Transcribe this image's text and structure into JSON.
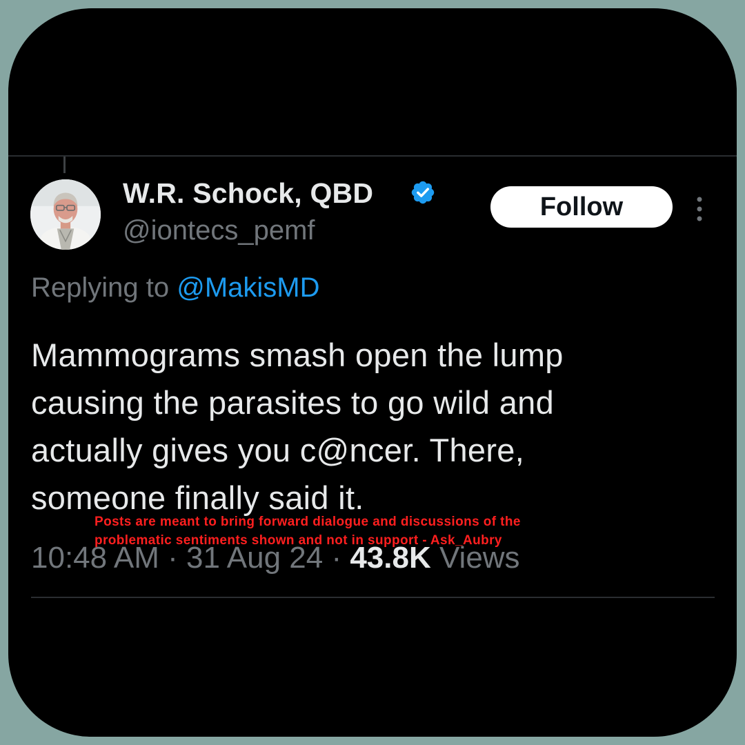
{
  "tweet": {
    "display_name": "W.R. Schock, QBD",
    "handle": "@iontecs_pemf",
    "verified": true,
    "follow_label": "Follow",
    "replying_prefix": "Replying to",
    "replying_handle": "@MakisMD",
    "text_lines": [
      "Mammograms smash open the lump",
      "causing the parasites to go wild and",
      "actually gives you c@ncer. There,",
      "someone finally said it."
    ],
    "time": "10:48 AM",
    "date": "31 Aug 24",
    "views_count": "43.8K",
    "views_label": "Views",
    "separator": " · "
  },
  "overlay": {
    "disclaimer_lines": [
      "Posts are meant to bring forward dialogue and discussions of the",
      "problematic sentiments shown and not in support - Ask_Aubry"
    ]
  },
  "icons": {
    "verified": "verified-badge-icon",
    "more": "more-options-icon",
    "avatar": "profile-photo"
  },
  "colors": {
    "page_background": "#86a6a2",
    "card_background": "#000000",
    "primary_text": "#e7e9ea",
    "secondary_text": "#71767b",
    "link": "#1d9bf0",
    "verified": "#1d9bf0",
    "disclaimer": "#ff1f1f"
  }
}
